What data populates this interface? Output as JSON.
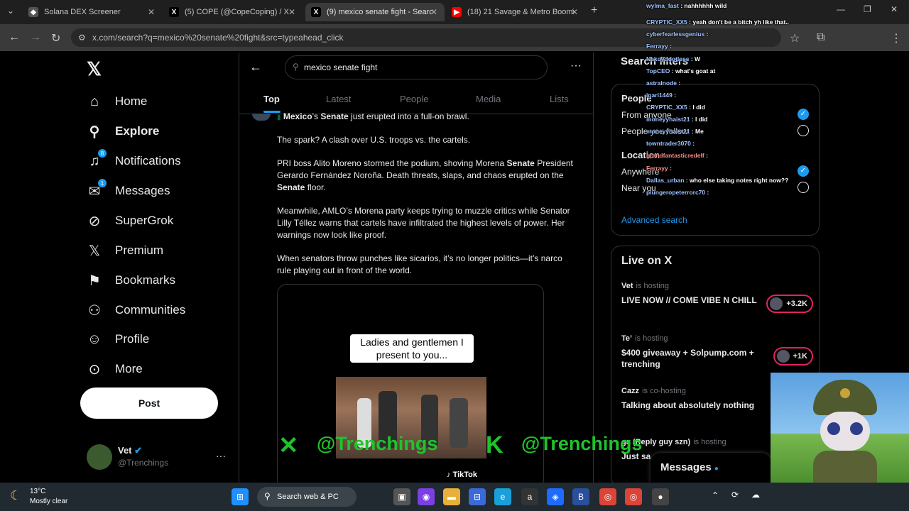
{
  "browser": {
    "tabs": [
      {
        "title": "Solana DEX Screener",
        "active": false
      },
      {
        "title": "(5) COPE (@CopeCoping) / X",
        "active": false
      },
      {
        "title": "(9) mexico senate fight - Search",
        "active": true
      },
      {
        "title": "(18) 21 Savage & Metro Boomin",
        "active": false
      }
    ],
    "url": "x.com/search?q=mexico%20senate%20fight&src=typeahead_click"
  },
  "nav": {
    "items": [
      {
        "label": "Home",
        "icon": "home-icon"
      },
      {
        "label": "Explore",
        "icon": "search-icon"
      },
      {
        "label": "Notifications",
        "icon": "bell-icon",
        "badge": "8"
      },
      {
        "label": "Messages",
        "icon": "mail-icon",
        "badge": "1"
      },
      {
        "label": "SuperGrok",
        "icon": "grok-icon"
      },
      {
        "label": "Premium",
        "icon": "x-logo-icon"
      },
      {
        "label": "Bookmarks",
        "icon": "bookmark-icon"
      },
      {
        "label": "Communities",
        "icon": "communities-icon"
      },
      {
        "label": "Profile",
        "icon": "person-icon"
      },
      {
        "label": "More",
        "icon": "more-icon"
      }
    ],
    "post_label": "Post",
    "account": {
      "name": "Vet",
      "handle": "@Trenchings"
    }
  },
  "search": {
    "query": "mexico senate fight",
    "tabs": [
      "Top",
      "Latest",
      "People",
      "Media",
      "Lists"
    ],
    "active_tab": "Top"
  },
  "post": {
    "first_line_parts": [
      "Mexico",
      "’s ",
      "Senate",
      " just erupted into a full-on brawl."
    ],
    "paragraphs": [
      "The spark? A clash over U.S. troops vs. the cartels.",
      "Meanwhile, AMLO’s Morena party keeps trying to muzzle critics while Senator Lilly Téllez warns that cartels have infiltrated the highest levels of power. Her warnings now look like proof.",
      "When senators throw punches like sicarios, it’s no longer politics—it’s narco rule playing out in front of the world."
    ],
    "para2_parts": [
      "PRI boss Alito Moreno stormed the podium, shoving Morena ",
      "Senate",
      " President Gerardo Fernández Noroña. Death threats, slaps, and chaos erupted on the ",
      "Senate",
      " floor."
    ],
    "video_caption": "Ladies and gentlemen I present to you...",
    "video_brand": "TikTok"
  },
  "right": {
    "filters_title": "Search filters",
    "people_label": "People",
    "from_anyone": "From anyone",
    "people_you_follow": "People you follow",
    "location_label": "Location",
    "anywhere": "Anywhere",
    "near_you": "Near you",
    "advanced_search": "Advanced search",
    "live_title": "Live on X",
    "live": [
      {
        "host": "Vet",
        "status": "is hosting",
        "title": "LIVE NOW // COME VIBE N CHILL",
        "count": "+3.2K"
      },
      {
        "host": "Te’",
        "status": "is hosting",
        "title": "$400 giveaway + Solpump.com + trenching",
        "count": "+1K"
      },
      {
        "host": "Cazz",
        "status": "is co-hosting",
        "title": "Talking about absolutely nothing",
        "count": ""
      },
      {
        "host": "ga (Reply guy szn)",
        "status": "is hosting",
        "title": "Just sa",
        "count": ""
      }
    ],
    "messages_label": "Messages"
  },
  "chat": [
    {
      "user": "wylma_fast",
      "msg": "nahhhhhh wild"
    },
    {
      "user": "CRYPTIC_XX5",
      "msg": "yeah don't be a bitch yh like that.."
    },
    {
      "user": "cyberfearlessgenius",
      "msg": ""
    },
    {
      "user": "Ferrayy",
      "msg": ""
    },
    {
      "user": "Nakoyddotless",
      "msg": "W"
    },
    {
      "user": "TopCEO",
      "msg": "what's goat at"
    },
    {
      "user": "astralnode",
      "msg": ""
    },
    {
      "user": "inari1449",
      "msg": ""
    },
    {
      "user": "CRYPTIC_XX5",
      "msg": "I did"
    },
    {
      "user": "moneyyhaist21",
      "msg": "I did"
    },
    {
      "user": "moneyyhaist21",
      "msg": "Me"
    },
    {
      "user": "towntrader3070",
      "msg": ""
    },
    {
      "user": "grandfantasticredelf",
      "msg": ""
    },
    {
      "user": "Ferrayy",
      "msg": ""
    },
    {
      "user": "Dallas_urban",
      "msg": "who else taking notes right now??"
    },
    {
      "user": "plungeropeterrorc70",
      "msg": ""
    }
  ],
  "watermark": {
    "left": "@Trenchings",
    "right": "@Trenchings"
  },
  "taskbar": {
    "weather_temp": "13°C",
    "weather_desc": "Mostly clear",
    "search_label": "Search web & PC"
  }
}
